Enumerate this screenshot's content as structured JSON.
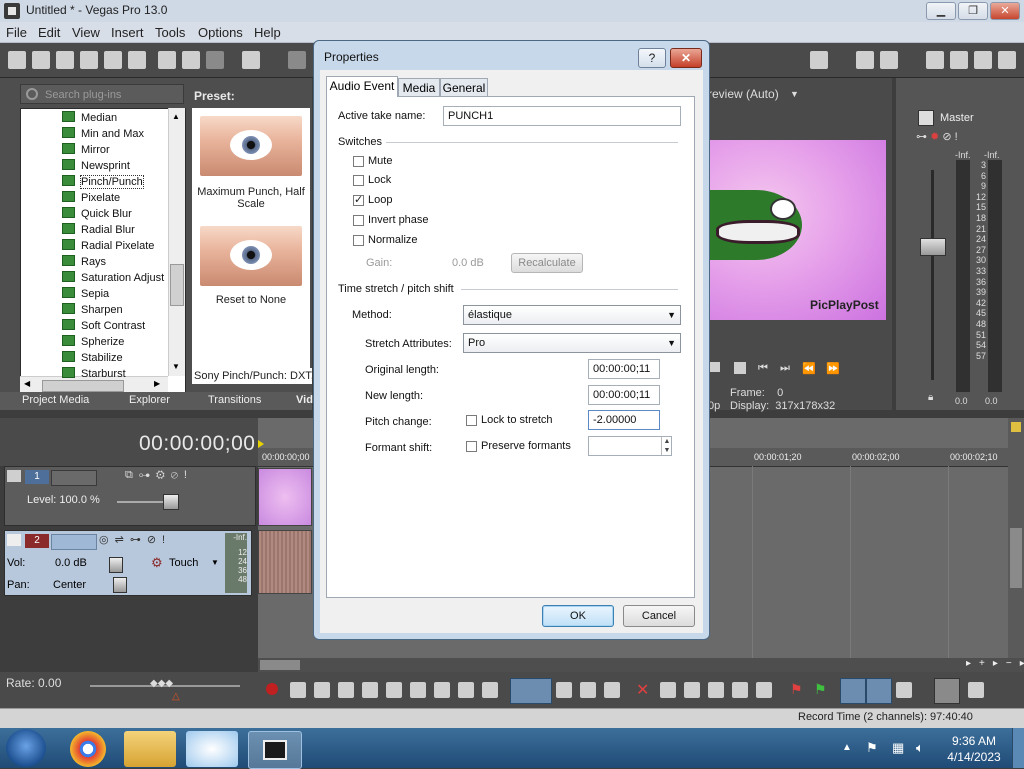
{
  "window": {
    "title": "Untitled * - Vegas Pro 13.0",
    "controls": {
      "minimize": "▁",
      "maximize": "❐",
      "close": "✕"
    }
  },
  "menu": [
    "File",
    "Edit",
    "View",
    "Insert",
    "Tools",
    "Options",
    "Help"
  ],
  "explorer": {
    "search_placeholder": "Search plug-ins",
    "preset_heading": "Preset:",
    "plugins": [
      "Median",
      "Min and Max",
      "Mirror",
      "Newsprint",
      "Pinch/Punch",
      "Pixelate",
      "Quick Blur",
      "Radial Blur",
      "Radial Pixelate",
      "Rays",
      "Saturation Adjust",
      "Sepia",
      "Sharpen",
      "Soft Contrast",
      "Spherize",
      "Stabilize",
      "Starburst"
    ],
    "selected_plugin": "Pinch/Punch",
    "presets": [
      "Maximum Punch, Half Scale",
      "Reset to None"
    ],
    "plugin_status": "Sony Pinch/Punch: DXT,",
    "tabs": [
      "Project Media",
      "Explorer",
      "Transitions",
      "Vid"
    ]
  },
  "preview": {
    "label": "review (Auto)",
    "watermark": "PicPlayPost",
    "frame_label": "Frame:",
    "frame_value": "0",
    "display_label": "Display:",
    "display_value": "317x178x32",
    "left_cut": "0p"
  },
  "master": {
    "label": "Master",
    "inf_left": "-Inf.",
    "inf_right": "-Inf.",
    "scale": [
      "3",
      "6",
      "9",
      "12",
      "15",
      "18",
      "21",
      "24",
      "27",
      "30",
      "33",
      "36",
      "39",
      "42",
      "45",
      "48",
      "51",
      "54",
      "57"
    ],
    "value_left": "0.0",
    "value_right": "0.0"
  },
  "timeline": {
    "timecode": "00:00:00;00",
    "ruler": [
      "00:00:00;00",
      "00:00:01;20",
      "00:00:02;00",
      "00:00:02;10"
    ],
    "track1": {
      "number": "1",
      "level": "Level: 100.0 %"
    },
    "track2": {
      "number": "2",
      "vol_label": "Vol:",
      "vol_value": "0.0 dB",
      "pan_label": "Pan:",
      "pan_value": "Center",
      "mode": "Touch",
      "meter_inf": "-Inf.",
      "meter_marks": [
        "12",
        "24",
        "36",
        "48"
      ]
    }
  },
  "transport": {
    "rate": "Rate: 0.00",
    "record_time": "Record Time (2 channels): 97:40:40"
  },
  "taskbar": {
    "time": "9:36 AM",
    "date": "4/14/2023"
  },
  "dialog": {
    "title": "Properties",
    "help_button": "?",
    "close_button": "✕",
    "tabs": [
      "Audio Event",
      "Media",
      "General"
    ],
    "active_tab": "Audio Event",
    "take_name_label": "Active take name:",
    "take_name_value": "PUNCH1",
    "switches_heading": "Switches",
    "switches": [
      {
        "label": "Mute",
        "checked": false
      },
      {
        "label": "Lock",
        "checked": false
      },
      {
        "label": "Loop",
        "checked": true
      },
      {
        "label": "Invert phase",
        "checked": false
      },
      {
        "label": "Normalize",
        "checked": false
      }
    ],
    "gain_label": "Gain:",
    "gain_value": "0.0 dB",
    "recalculate_button": "Recalculate",
    "stretch_heading": "Time stretch / pitch shift",
    "method_label": "Method:",
    "method_value": "élastique",
    "stretch_attr_label": "Stretch Attributes:",
    "stretch_attr_value": "Pro",
    "orig_length_label": "Original length:",
    "orig_length_value": "00:00:00;11",
    "new_length_label": "New length:",
    "new_length_value": "00:00:00;11",
    "pitch_label": "Pitch change:",
    "lock_stretch_label": "Lock to stretch",
    "pitch_value": "-2.00000",
    "formant_label": "Formant shift:",
    "preserve_formants_label": "Preserve formants",
    "formant_value": "",
    "ok_button": "OK",
    "cancel_button": "Cancel"
  }
}
